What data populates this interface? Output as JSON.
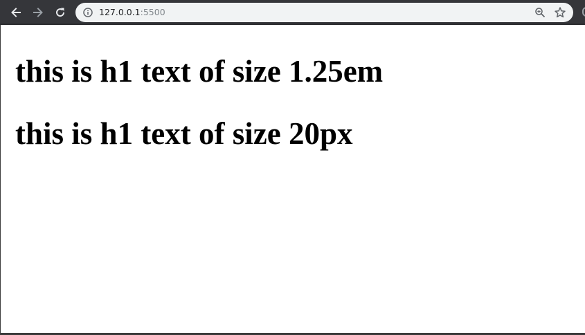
{
  "browser": {
    "url_host": "127.0.0.1",
    "url_port": ":5500",
    "icons": {
      "back": "arrow-left-icon",
      "forward": "arrow-right-icon",
      "reload": "reload-icon",
      "info": "info-icon",
      "zoom": "zoom-icon",
      "bookmark": "star-icon"
    },
    "colors": {
      "toolbar": "#35363a",
      "omnibox": "#f1f3f4",
      "icon_active": "#e8eaed",
      "icon_disabled": "#9aa0a6"
    }
  },
  "page": {
    "headings": [
      "this is h1 text of size 1.25em",
      "this is h1 text of size 20px"
    ]
  }
}
